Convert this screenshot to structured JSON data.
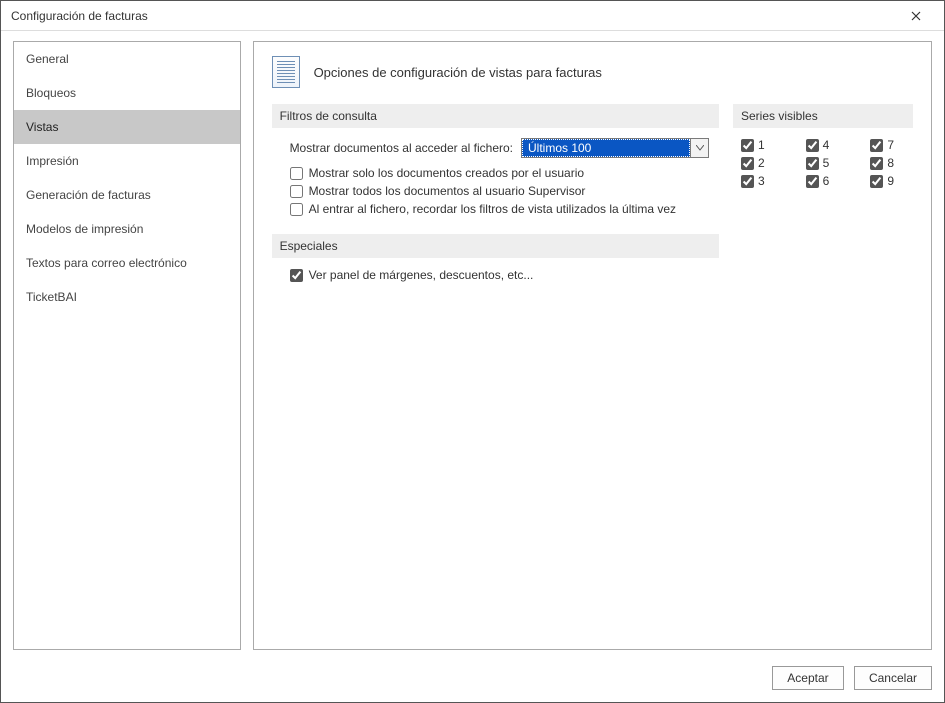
{
  "window": {
    "title": "Configuración de facturas"
  },
  "sidebar": {
    "items": [
      {
        "label": "General"
      },
      {
        "label": "Bloqueos"
      },
      {
        "label": "Vistas"
      },
      {
        "label": "Impresión"
      },
      {
        "label": "Generación de facturas"
      },
      {
        "label": "Modelos de impresión"
      },
      {
        "label": "Textos para correo electrónico"
      },
      {
        "label": "TicketBAI"
      }
    ],
    "selected_index": 2
  },
  "main": {
    "title": "Opciones de configuración de vistas para facturas",
    "filtros": {
      "heading": "Filtros de consulta",
      "mostrar_label": "Mostrar documentos al acceder al fichero:",
      "mostrar_value": "Últimos 100",
      "check1": {
        "label": "Mostrar solo los documentos creados por el usuario",
        "checked": false
      },
      "check2": {
        "label": "Mostrar todos los documentos al usuario Supervisor",
        "checked": false
      },
      "check3": {
        "label": "Al entrar al fichero, recordar los filtros de vista utilizados la última vez",
        "checked": false
      }
    },
    "series": {
      "heading": "Series visibles",
      "items": [
        {
          "label": "1",
          "checked": true
        },
        {
          "label": "2",
          "checked": true
        },
        {
          "label": "3",
          "checked": true
        },
        {
          "label": "4",
          "checked": true
        },
        {
          "label": "5",
          "checked": true
        },
        {
          "label": "6",
          "checked": true
        },
        {
          "label": "7",
          "checked": true
        },
        {
          "label": "8",
          "checked": true
        },
        {
          "label": "9",
          "checked": true
        }
      ]
    },
    "especiales": {
      "heading": "Especiales",
      "panel": {
        "label": "Ver panel de márgenes, descuentos, etc...",
        "checked": true
      }
    }
  },
  "footer": {
    "accept": "Aceptar",
    "cancel": "Cancelar"
  }
}
